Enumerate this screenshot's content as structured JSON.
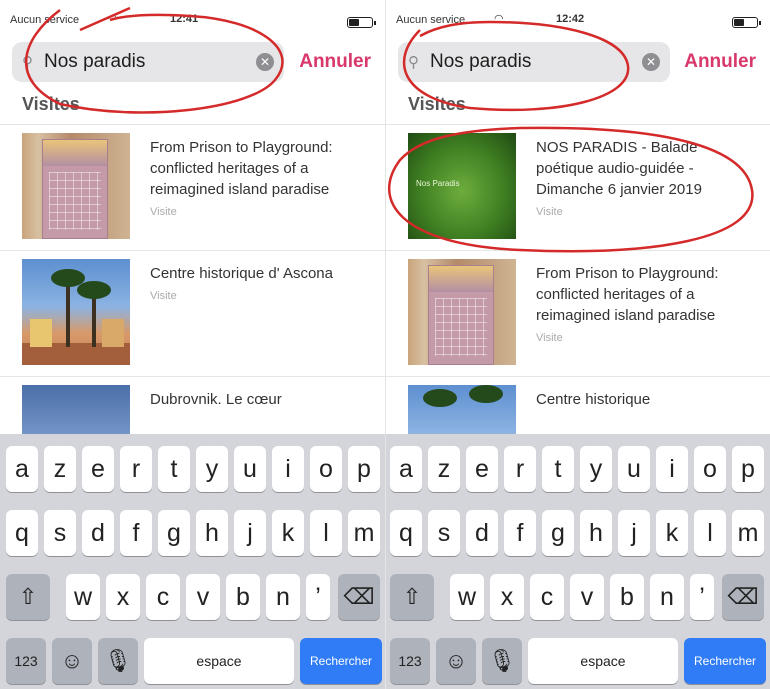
{
  "panes": [
    {
      "status": {
        "carrier": "Aucun service",
        "time": "12:41"
      },
      "search": {
        "value": "Nos paradis",
        "cancel_label": "Annuler"
      },
      "section_header": "Visites",
      "results": [
        {
          "title": "From Prison to Playground: conflicted heritages of a reimagined island paradise",
          "type": "Visite",
          "thumb": "book"
        },
        {
          "title": "Centre historique d' Ascona",
          "type": "Visite",
          "thumb": "palm"
        },
        {
          "title": "Dubrovnik. Le cœur",
          "type": "",
          "thumb": "sea"
        }
      ]
    },
    {
      "status": {
        "carrier": "Aucun service",
        "time": "12:42"
      },
      "search": {
        "value": "Nos paradis",
        "cancel_label": "Annuler"
      },
      "section_header": "Visites",
      "results": [
        {
          "title": "NOS PARADIS - Balade poétique audio-guidée - Dimanche 6 janvier 2019",
          "type": "Visite",
          "thumb": "grass",
          "thumb_label": "Nos Paradis"
        },
        {
          "title": "From Prison to Playground: conflicted heritages of a reimagined island paradise",
          "type": "Visite",
          "thumb": "book"
        },
        {
          "title": "Centre historique",
          "type": "",
          "thumb": "palm"
        }
      ]
    }
  ],
  "keyboard": {
    "row1": [
      "a",
      "z",
      "e",
      "r",
      "t",
      "y",
      "u",
      "i",
      "o",
      "p"
    ],
    "row2": [
      "q",
      "s",
      "d",
      "f",
      "g",
      "h",
      "j",
      "k",
      "l",
      "m"
    ],
    "row3": [
      "w",
      "x",
      "c",
      "v",
      "b",
      "n",
      "’"
    ],
    "numbers_label": "123",
    "space_label": "espace",
    "search_label": "Rechercher"
  },
  "colors": {
    "accent": "#d8386a",
    "search_key": "#2f7cf6",
    "annotation": "#d42a2a"
  }
}
